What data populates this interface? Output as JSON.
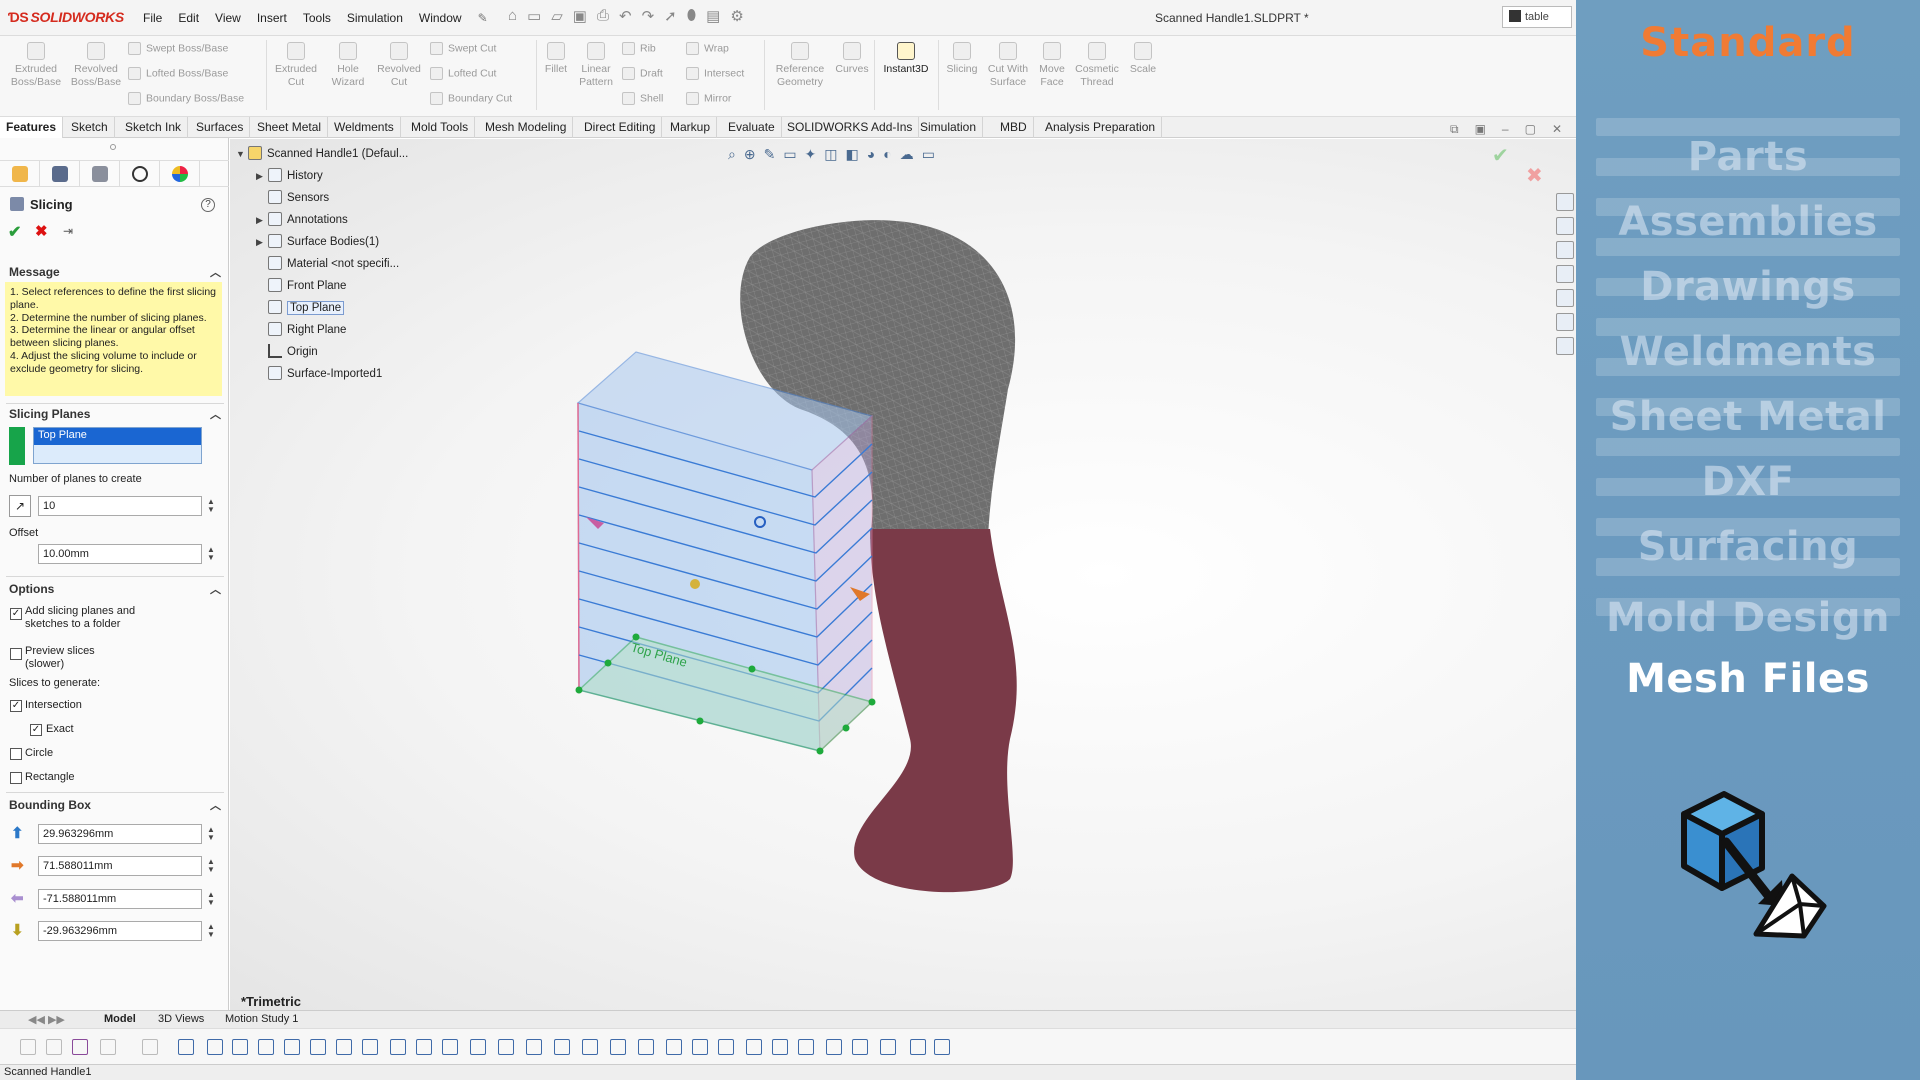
{
  "app": {
    "logo_text": "SOLIDWORKS",
    "document_title": "Scanned Handle1.SLDPRT *",
    "search_text": "table"
  },
  "menu": [
    "File",
    "Edit",
    "View",
    "Insert",
    "Tools",
    "Simulation",
    "Window"
  ],
  "ribbon": {
    "extruded_boss": "Extruded Boss/Base",
    "revolved_boss": "Revolved Boss/Base",
    "swept_boss": "Swept Boss/Base",
    "lofted_boss": "Lofted Boss/Base",
    "boundary_boss": "Boundary Boss/Base",
    "extruded_cut": "Extruded Cut",
    "hole_wizard": "Hole Wizard",
    "revolved_cut": "Revolved Cut",
    "swept_cut": "Swept Cut",
    "lofted_cut": "Lofted Cut",
    "boundary_cut": "Boundary Cut",
    "fillet": "Fillet",
    "linear_pattern": "Linear Pattern",
    "rib": "Rib",
    "draft": "Draft",
    "shell": "Shell",
    "wrap": "Wrap",
    "intersect": "Intersect",
    "mirror": "Mirror",
    "reference_geometry": "Reference Geometry",
    "curves": "Curves",
    "instant3d": "Instant3D",
    "slicing": "Slicing",
    "cut_with_surface": "Cut With Surface",
    "move_face": "Move Face",
    "cosmetic_thread": "Cosmetic Thread",
    "scale": "Scale"
  },
  "tabs": [
    "Features",
    "Sketch",
    "Sketch Ink",
    "Surfaces",
    "Sheet Metal",
    "Weldments",
    "Mold Tools",
    "Mesh Modeling",
    "Direct Editing",
    "Markup",
    "Evaluate",
    "SOLIDWORKS Add-Ins",
    "Simulation",
    "MBD",
    "Analysis Preparation"
  ],
  "property_manager": {
    "title": "Slicing",
    "message_header": "Message",
    "message_lines": [
      "1. Select references to define the first slicing plane.",
      "2. Determine the number of slicing planes.",
      "3. Determine the linear or angular offset between slicing planes.",
      "4. Adjust the slicing volume to include or exclude geometry for slicing."
    ],
    "slicing_planes_header": "Slicing Planes",
    "selected_plane": "Top Plane",
    "num_planes_label": "Number of planes to create",
    "num_planes_value": "10",
    "offset_label": "Offset",
    "offset_value": "10.00mm",
    "options_header": "Options",
    "opt_add_folder": "Add slicing planes and sketches to a folder",
    "opt_preview": "Preview slices (slower)",
    "slices_to_generate": "Slices to generate:",
    "opt_intersection": "Intersection",
    "opt_exact": "Exact",
    "opt_circle": "Circle",
    "opt_rectangle": "Rectangle",
    "bounding_box_header": "Bounding Box",
    "bbox_top": "29.963296mm",
    "bbox_right": "71.588011mm",
    "bbox_left": "-71.588011mm",
    "bbox_bottom": "-29.963296mm"
  },
  "tree": {
    "root": "Scanned Handle1 (Defaul...",
    "items": [
      "History",
      "Sensors",
      "Annotations",
      "Surface Bodies(1)",
      "Material <not specifi...",
      "Front Plane",
      "Top Plane",
      "Right Plane",
      "Origin",
      "Surface-Imported1"
    ]
  },
  "viewport": {
    "view_name": "*Trimetric",
    "plane_label": "Top Plane"
  },
  "bottom_tabs": [
    "Model",
    "3D Views",
    "Motion Study 1"
  ],
  "status_bar": "Scanned Handle1",
  "overlay": {
    "title": "Standard",
    "title_color": "#f07b34",
    "items": [
      "Parts",
      "Assemblies",
      "Drawings",
      "Weldments",
      "Sheet Metal",
      "DXF",
      "Surfacing",
      "Mold Design",
      "Mesh Files"
    ],
    "current_item": "Mesh Files"
  }
}
